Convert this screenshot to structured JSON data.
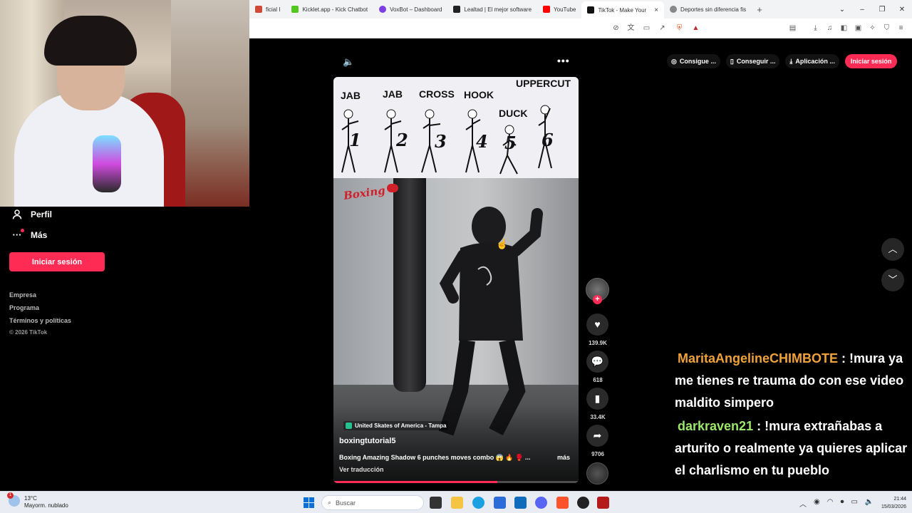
{
  "browser": {
    "tabs": [
      {
        "label": "ficial I",
        "color": "#d04a3a",
        "active": false
      },
      {
        "label": "Kicklet.app - Kick Chatbot",
        "color": "#53c71e",
        "active": false
      },
      {
        "label": "VoxBot – Dashboard",
        "color": "#7b3fe4",
        "active": false
      },
      {
        "label": "Lealtad | El mejor software",
        "color": "#222222",
        "active": false
      },
      {
        "label": "YouTube",
        "color": "#ff0000",
        "active": false
      },
      {
        "label": "TikTok - Make Your",
        "color": "#111111",
        "active": true
      },
      {
        "label": "Deportes sin diferencia fis",
        "color": "#888888",
        "active": false
      }
    ],
    "close_glyph": "×",
    "new_tab_glyph": "+"
  },
  "sidebar": {
    "items": [
      {
        "label": "Perfil",
        "icon": "person-icon"
      },
      {
        "label": "Más",
        "icon": "more-dots-icon"
      }
    ],
    "login_label": "Iniciar sesión",
    "footer_links": [
      "Empresa",
      "Programa",
      "Términos y políticas"
    ],
    "copyright": "© 2026 TikTok"
  },
  "video": {
    "moves": [
      {
        "label": "JAB",
        "number": "1"
      },
      {
        "label": "JAB",
        "number": "2"
      },
      {
        "label": "CROSS",
        "number": "3"
      },
      {
        "label": "HOOK",
        "number": "4"
      },
      {
        "label": "DUCK",
        "number": "5"
      },
      {
        "label": "UPPERCUT",
        "number": "6"
      }
    ],
    "overlay_tag": "Boxing",
    "location": "United Skates of America - Tampa",
    "author": "boxingtutorial5",
    "caption": "Boxing Amazing Shadow 6 punches moves combo 😱 🔥 🥊 ...",
    "more_label": "más",
    "translate_label": "Ver traducción",
    "progress": 0.67
  },
  "rail": {
    "likes": "139.9K",
    "comments": "618",
    "saves": "33.4K",
    "shares": "9706",
    "follow_glyph": "+"
  },
  "top_actions": [
    {
      "label": "Consigue ...",
      "icon": "coin-icon"
    },
    {
      "label": "Conseguir ...",
      "icon": "phone-icon"
    },
    {
      "label": "Aplicación ...",
      "icon": "download-icon"
    }
  ],
  "top_login_label": "Iniciar sesión",
  "chat": [
    {
      "user": "MaritaAngelineCHIMBOTE",
      "user_color": "#f0a23a",
      "text": ": !mura ya me tienes re trauma do con ese video maldito simpero"
    },
    {
      "user": "darkraven21",
      "user_color": "#9be86a",
      "text": ": !mura extrañabas a arturito o realmente ya quieres aplicar el charlismo en tu pueblo"
    }
  ],
  "taskbar": {
    "temperature": "13°C",
    "weather_desc": "Mayorm. nublado",
    "weather_badge": "1",
    "search_placeholder": "Buscar",
    "time": "21:44",
    "date": "15/03/2026"
  },
  "colors": {
    "accent": "#fe2c55",
    "background": "#000000"
  }
}
